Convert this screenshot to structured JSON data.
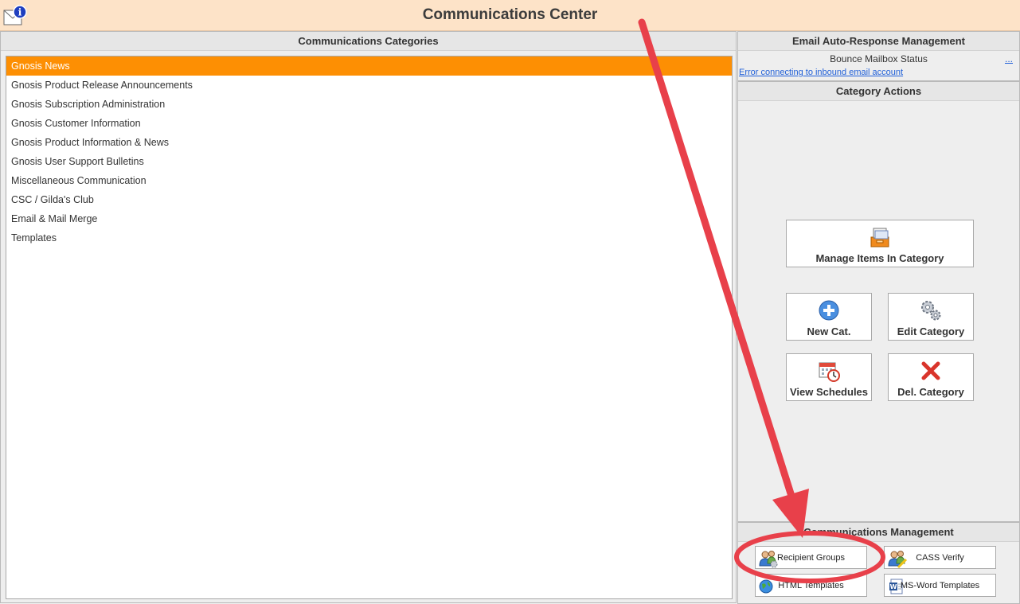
{
  "app": {
    "title": "Communications Center",
    "icon": "mail-info-icon"
  },
  "categories_panel": {
    "header": "Communications Categories",
    "items": [
      {
        "label": "Gnosis News",
        "selected": true
      },
      {
        "label": "Gnosis Product Release Announcements"
      },
      {
        "label": "Gnosis Subscription Administration"
      },
      {
        "label": "Gnosis Customer Information"
      },
      {
        "label": "Gnosis Product Information & News"
      },
      {
        "label": "Gnosis User Support Bulletins"
      },
      {
        "label": "Miscellaneous Communication"
      },
      {
        "label": "CSC / Gilda's Club"
      },
      {
        "label": "Email & Mail Merge"
      },
      {
        "label": "Templates"
      }
    ]
  },
  "email_panel": {
    "header": "Email Auto-Response Management",
    "bounce_label": "Bounce Mailbox Status",
    "more_link": "...",
    "error_link": "Error connecting to inbound email account"
  },
  "actions_panel": {
    "header": "Category Actions",
    "manage": {
      "label": "Manage Items In Category",
      "icon": "file-cabinet-icon"
    },
    "new_cat": {
      "label": "New Cat.",
      "icon": "plus-circle-icon"
    },
    "edit": {
      "label": "Edit Category",
      "icon": "gears-icon"
    },
    "schedules": {
      "label": "View Schedules",
      "icon": "calendar-clock-icon"
    },
    "delete": {
      "label": "Del. Category",
      "icon": "red-x-icon"
    }
  },
  "management_panel": {
    "header": "Communications Management",
    "recipient_groups": {
      "label": "Recipient Groups",
      "icon": "users-gear-icon"
    },
    "cass_verify": {
      "label": "CASS Verify",
      "icon": "users-pencil-icon"
    },
    "html_templates": {
      "label": "HTML Templates",
      "icon": "globe-icon"
    },
    "word_templates": {
      "label": "MS-Word Templates",
      "icon": "word-doc-icon"
    }
  },
  "colors": {
    "title_bg": "#fde3c8",
    "selection": "#fd8f03",
    "annotation": "#e8404a",
    "link": "#1f5fd8"
  }
}
